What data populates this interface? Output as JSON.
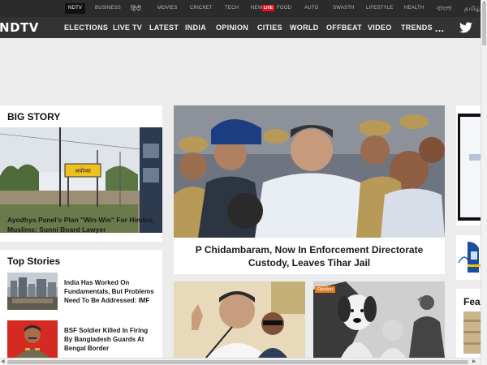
{
  "topstrip": {
    "links": [
      "NDTV",
      "BUSINESS",
      "हिंदी",
      "MOVIES",
      "CRICKET",
      "TECH",
      "NEWS",
      "FOOD",
      "AUTO",
      "SWASTH",
      "LIFESTYLE",
      "HEALTH",
      "বাংলা",
      "தமிழ்"
    ],
    "live_label": "LIVE"
  },
  "nav": {
    "logo": "NDTV",
    "items": [
      "ELECTIONS",
      "LIVE TV",
      "LATEST",
      "INDIA",
      "OPINION",
      "CITIES",
      "WORLD",
      "OFFBEAT",
      "VIDEO",
      "TRENDS"
    ],
    "more": "..."
  },
  "big_story": {
    "heading": "BIG STORY",
    "headline": "Ayodhya Panel's Plan \"Win-Win\" For Hindus, Muslims: Sunni Board Lawyer",
    "sign_text": "अयोध्या"
  },
  "lead_story": {
    "headline": "P Chidambaram, Now In Enforcement Directorate Custody, Leaves Tihar Jail"
  },
  "top_stories": {
    "heading": "Top Stories",
    "items": [
      {
        "headline": "India Has Worked On Fundamentals, But Problems Need To Be Addressed: IMF"
      },
      {
        "headline": "BSF Soldier Killed In Firing By Bangladesh Guards At Bengal Border"
      }
    ]
  },
  "secondary": {
    "badge": "Opinion",
    "partial_heading": "Fea"
  },
  "colors": {
    "topstrip_bg": "#2b2b2b",
    "nav_bg": "#333333",
    "brand_red": "#e4101c",
    "page_bg": "#ececec"
  }
}
